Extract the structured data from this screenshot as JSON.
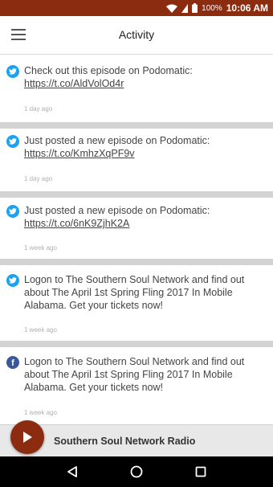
{
  "status_bar": {
    "battery": "100%",
    "time": "10:06 AM"
  },
  "app_bar": {
    "title": "Activity"
  },
  "feed": [
    {
      "source": "twitter",
      "text": "Check out this episode on Podomatic: ",
      "link": "https://t.co/AldVolOd4r",
      "time": "1 day ago"
    },
    {
      "source": "twitter",
      "text": "Just posted a new episode on Podomatic: ",
      "link": "https://t.co/KmhzXqPF9v",
      "time": "1 day ago"
    },
    {
      "source": "twitter",
      "text": "Just posted a new episode on Podomatic: ",
      "link": "https://t.co/6nK9ZjhK2A",
      "time": "1 week ago"
    },
    {
      "source": "twitter",
      "text": "Logon to The Southern Soul Network and find out about The April 1st Spring Fling 2017 In Mobile Alabama. Get your tickets now!",
      "link": "",
      "time": "1 week ago"
    },
    {
      "source": "facebook",
      "text": "Logon to The Southern Soul Network and find out about The April 1st Spring Fling 2017 In Mobile Alabama. Get your tickets now!",
      "link": "",
      "time": "1 week ago"
    }
  ],
  "player": {
    "station": "Southern Soul Network Radio"
  },
  "colors": {
    "brand": "#8b2b10",
    "twitter": "#1da1f2",
    "facebook": "#3b5998"
  }
}
